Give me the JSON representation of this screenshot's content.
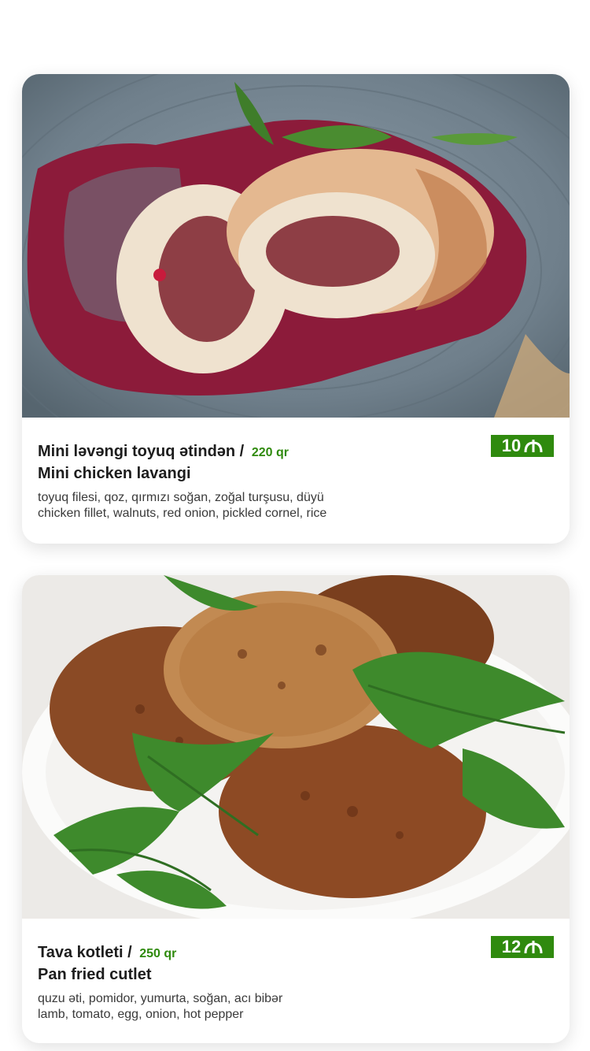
{
  "items": [
    {
      "title_az": "Mini ləvəngi toyuq ətindən /",
      "weight": "220 qr",
      "title_en": "Mini chicken lavangi",
      "ingredients_az": "toyuq filesi, qoz, qırmızı soğan, zoğal turşusu, düyü",
      "ingredients_en": "chicken fillet, walnuts, red onion, pickled cornel, rice",
      "price": "10",
      "currency_icon": "manat-icon",
      "photo": "chicken-lavangi-photo"
    },
    {
      "title_az": "Tava kotleti /",
      "weight": "250 qr",
      "title_en": "Pan fried cutlet",
      "ingredients_az": "quzu əti, pomidor, yumurta, soğan, acı bibər",
      "ingredients_en": "lamb, tomato, egg, onion, hot pepper",
      "price": "12",
      "currency_icon": "manat-icon",
      "photo": "pan-fried-cutlet-photo"
    }
  ],
  "colors": {
    "accent": "#2f8a0e",
    "card_bg": "#ffffff"
  }
}
